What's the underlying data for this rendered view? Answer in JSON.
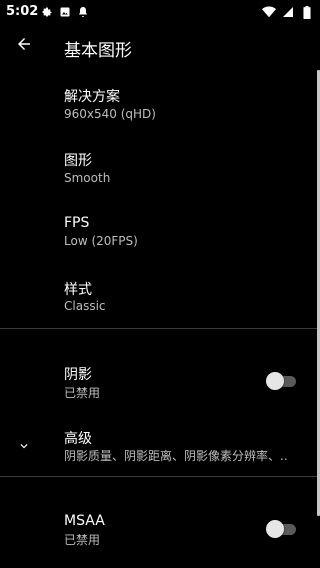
{
  "status_bar": {
    "time": "5:02",
    "left_icons": [
      "settings-gear-icon",
      "image-icon",
      "notification-ghost-icon"
    ],
    "right_icons": [
      "wifi-icon",
      "cellular-signal-icon",
      "battery-icon"
    ]
  },
  "app_bar": {
    "back_icon": "arrow-left-icon",
    "title": "基本图形"
  },
  "preferences": [
    {
      "id": "resolution",
      "title": "解决方案",
      "summary": "960x540 (qHD)"
    },
    {
      "id": "graphics",
      "title": "图形",
      "summary": "Smooth"
    },
    {
      "id": "fps",
      "title": "FPS",
      "summary": "Low (20FPS)"
    },
    {
      "id": "style",
      "title": "样式",
      "summary": "Classic"
    }
  ],
  "shadows": {
    "title": "阴影",
    "summary": "已禁用",
    "enabled": false
  },
  "advanced": {
    "title": "高级",
    "summary": "阴影质量、阴影距离、阴影像素分辨率、..",
    "expand_icon": "chevron-down-icon"
  },
  "msaa": {
    "title": "MSAA",
    "summary": "已禁用",
    "enabled": false
  },
  "colors": {
    "background": "#000000",
    "summary_text": "#bdbdbd",
    "toggle_thumb_off": "#e6e6e6",
    "toggle_track_off": "#5a5a5a"
  }
}
